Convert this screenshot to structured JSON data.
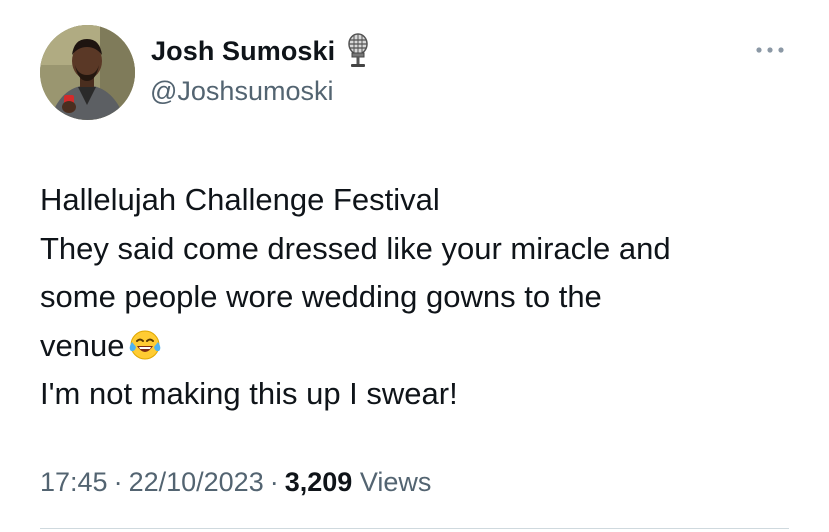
{
  "author": {
    "display_name": "Josh Sumoski",
    "name_emoji": "microphone-icon",
    "handle": "@Joshsumoski"
  },
  "tweet": {
    "lines": [
      "Hallelujah Challenge Festival",
      "They said come dressed like your miracle and",
      "some people wore wedding gowns to the",
      "venue",
      "I'm not making this up I swear!"
    ],
    "inline_emoji": "face-with-tears-of-joy-icon"
  },
  "meta": {
    "time": "17:45",
    "separator": "·",
    "date": "22/10/2023",
    "views_count": "3,209",
    "views_label": "Views"
  },
  "colors": {
    "text_primary": "#0f1419",
    "text_secondary": "#536471",
    "divider": "#cfd9de"
  }
}
